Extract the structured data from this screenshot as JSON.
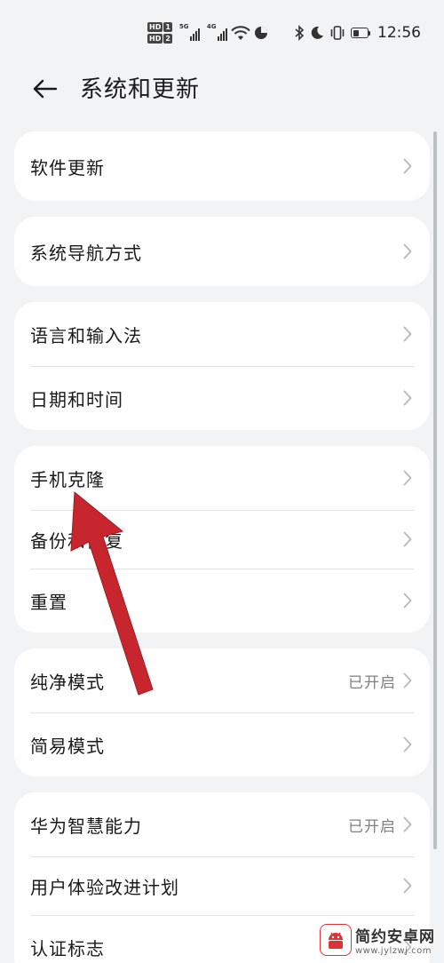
{
  "status_bar": {
    "hd1": "HD",
    "hd1_num": "1",
    "hd2": "HD",
    "hd2_num": "2",
    "net1": "5G",
    "net2": "4G",
    "time": "12:56",
    "battery_level": 0.45
  },
  "header": {
    "title": "系统和更新"
  },
  "groups": [
    {
      "items": [
        {
          "label": "软件更新"
        }
      ]
    },
    {
      "items": [
        {
          "label": "系统导航方式"
        }
      ]
    },
    {
      "items": [
        {
          "label": "语言和输入法"
        },
        {
          "label": "日期和时间"
        }
      ]
    },
    {
      "items": [
        {
          "label": "手机克隆"
        },
        {
          "label": "备份和恢复"
        },
        {
          "label": "重置"
        }
      ]
    },
    {
      "items": [
        {
          "label": "纯净模式",
          "value": "已开启"
        },
        {
          "label": "简易模式"
        }
      ]
    },
    {
      "items": [
        {
          "label": "华为智慧能力",
          "value": "已开启"
        },
        {
          "label": "用户体验改进计划"
        },
        {
          "label": "认证标志"
        }
      ]
    }
  ],
  "watermark": {
    "title": "简约安卓网",
    "url": "www.jylzwj.com"
  },
  "colors": {
    "background": "#f1f3f5",
    "card": "#ffffff",
    "annotation_arrow": "#c8262e"
  }
}
